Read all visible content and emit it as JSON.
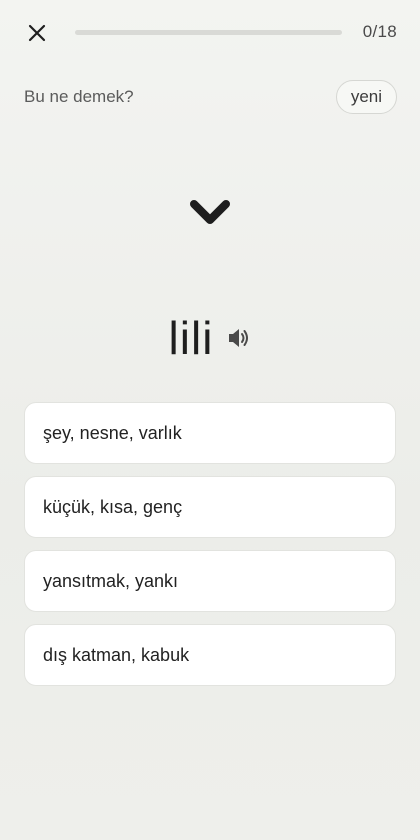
{
  "header": {
    "progress_count": "0/18",
    "progress_fraction": 0
  },
  "prompt": {
    "question": "Bu ne demek?",
    "badge": "yeni"
  },
  "card": {
    "word": "lili"
  },
  "options": [
    {
      "label": "şey, nesne, varlık"
    },
    {
      "label": "küçük, kısa, genç"
    },
    {
      "label": "yansıtmak, yankı"
    },
    {
      "label": "dış katman, kabuk"
    }
  ],
  "icons": {
    "close": "close-icon",
    "chevron": "chevron-down-icon",
    "speaker": "speaker-icon"
  },
  "colors": {
    "background": "#eeefeb",
    "option_background": "#ffffff",
    "text": "#1f1f1f"
  }
}
